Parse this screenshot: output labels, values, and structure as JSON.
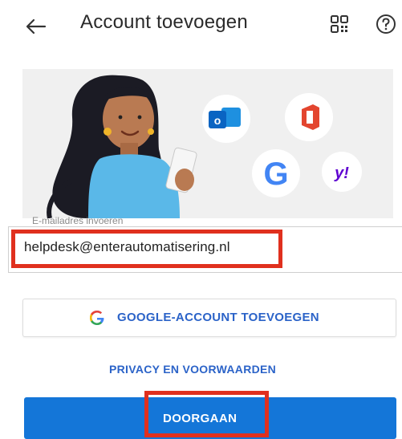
{
  "header": {
    "back_icon": "arrow-left-icon",
    "title": "Account toevoegen",
    "qr_icon": "qr-code-icon",
    "help_icon": "help-circle-icon"
  },
  "hero": {
    "logos": [
      "outlook-logo",
      "office-logo",
      "google-logo",
      "yahoo-logo"
    ],
    "yahoo_text": "y!"
  },
  "email": {
    "label": "E-mailadres invoeren",
    "value": "helpdesk@enterautomatisering.nl"
  },
  "google_button": {
    "icon": "google-g-icon",
    "label": "GOOGLE-ACCOUNT TOEVOEGEN"
  },
  "privacy_link": {
    "label": "PRIVACY EN VOORWAARDEN"
  },
  "continue_button": {
    "label": "DOORGAAN"
  },
  "colors": {
    "accent_blue": "#1476d8",
    "link_blue": "#2b63c8",
    "highlight_red": "#e0301e",
    "hero_bg": "#f0f0f0"
  }
}
